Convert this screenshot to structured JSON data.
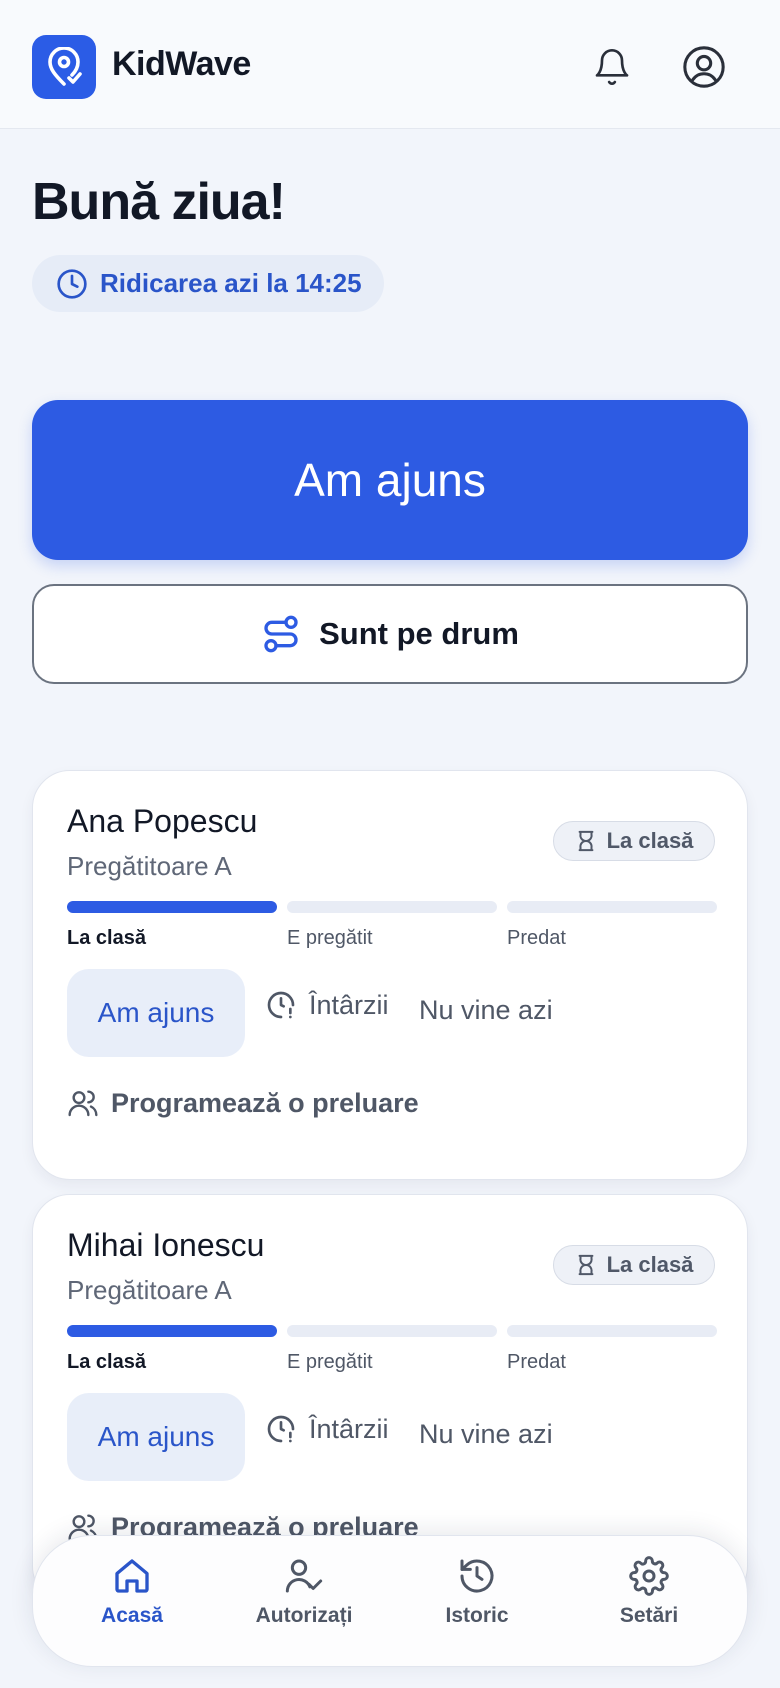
{
  "header": {
    "app_name": "KidWave",
    "icons": [
      "location-logo-icon",
      "bell-icon",
      "user-circle-icon"
    ]
  },
  "greeting": "Bună ziua!",
  "pickup": {
    "text": "Ridicarea azi la 14:25",
    "icon": "clock-icon"
  },
  "actions": {
    "arrived": "Am ajuns",
    "on_the_way": "Sunt pe drum",
    "on_the_way_icon": "route-icon"
  },
  "children": [
    {
      "name": "Ana Popescu",
      "class": "Pregătitoare A",
      "status": "La clasă",
      "status_icon": "hourglass-icon",
      "steps": [
        "La clasă",
        "E pregătit",
        "Predat"
      ],
      "current_step": 1,
      "arrived_label": "Am ajuns",
      "late_label": "Întârzii",
      "absent_label": "Nu vine azi",
      "schedule_label": "Programează o preluare"
    },
    {
      "name": "Mihai Ionescu",
      "class": "Pregătitoare A",
      "status": "La clasă",
      "status_icon": "hourglass-icon",
      "steps": [
        "La clasă",
        "E pregătit",
        "Predat"
      ],
      "current_step": 1,
      "arrived_label": "Am ajuns",
      "late_label": "Întârzii",
      "absent_label": "Nu vine azi",
      "schedule_label": "Programează o preluare"
    }
  ],
  "nav": {
    "items": [
      {
        "label": "Acasă",
        "icon": "home-icon",
        "active": true
      },
      {
        "label": "Autorizați",
        "icon": "user-check-icon",
        "active": false
      },
      {
        "label": "Istoric",
        "icon": "history-icon",
        "active": false
      },
      {
        "label": "Setări",
        "icon": "settings-icon",
        "active": false
      }
    ]
  },
  "colors": {
    "accent": "#2d5be3",
    "background": "#f2f5fb",
    "muted_text": "#4f5766"
  }
}
